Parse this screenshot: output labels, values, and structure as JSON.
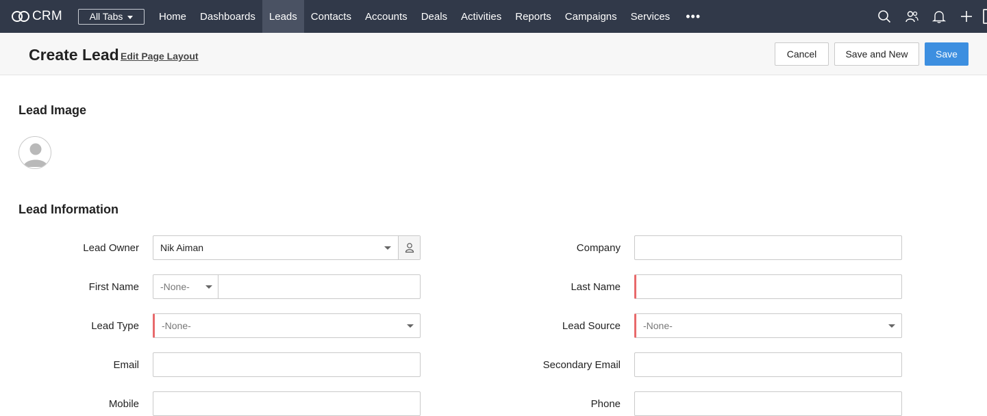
{
  "brand": {
    "name": "CRM"
  },
  "all_tabs": {
    "label": "All Tabs"
  },
  "nav": {
    "items": [
      {
        "label": "Home",
        "active": false
      },
      {
        "label": "Dashboards",
        "active": false
      },
      {
        "label": "Leads",
        "active": true
      },
      {
        "label": "Contacts",
        "active": false
      },
      {
        "label": "Accounts",
        "active": false
      },
      {
        "label": "Deals",
        "active": false
      },
      {
        "label": "Activities",
        "active": false
      },
      {
        "label": "Reports",
        "active": false
      },
      {
        "label": "Campaigns",
        "active": false
      },
      {
        "label": "Services",
        "active": false
      }
    ],
    "more": "•••",
    "icons": [
      "search-icon",
      "users-icon",
      "bell-icon",
      "plus-icon"
    ]
  },
  "page": {
    "title": "Create Lead",
    "edit_layout": "Edit Page Layout",
    "buttons": {
      "cancel": "Cancel",
      "save_new": "Save and New",
      "save": "Save"
    }
  },
  "sections": {
    "image": {
      "title": "Lead Image"
    },
    "info": {
      "title": "Lead Information"
    }
  },
  "form": {
    "lead_owner": {
      "label": "Lead Owner",
      "value": "Nik Aiman"
    },
    "company": {
      "label": "Company",
      "value": ""
    },
    "first_name": {
      "label": "First Name",
      "salutation": "-None-",
      "value": ""
    },
    "last_name": {
      "label": "Last Name",
      "value": ""
    },
    "lead_type": {
      "label": "Lead Type",
      "value": "-None-"
    },
    "lead_source": {
      "label": "Lead Source",
      "value": "-None-"
    },
    "email": {
      "label": "Email",
      "value": ""
    },
    "secondary_email": {
      "label": "Secondary Email",
      "value": ""
    },
    "mobile": {
      "label": "Mobile",
      "value": ""
    },
    "phone": {
      "label": "Phone",
      "value": ""
    }
  },
  "colors": {
    "nav_bg": "#313949",
    "nav_active": "#4a5263",
    "primary": "#3d8fe0",
    "mandatory": "#e8696b"
  }
}
